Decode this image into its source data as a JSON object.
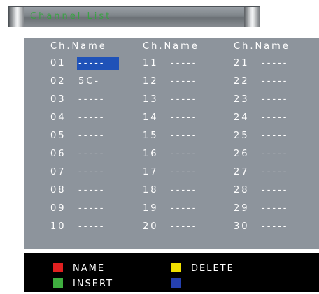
{
  "title": "Channel List",
  "column_header": "Ch.Name",
  "selected_channel": "01",
  "channels": [
    {
      "num": "01",
      "name": "-----"
    },
    {
      "num": "02",
      "name": "5C-"
    },
    {
      "num": "03",
      "name": "-----"
    },
    {
      "num": "04",
      "name": "-----"
    },
    {
      "num": "05",
      "name": "-----"
    },
    {
      "num": "06",
      "name": "-----"
    },
    {
      "num": "07",
      "name": "-----"
    },
    {
      "num": "08",
      "name": "-----"
    },
    {
      "num": "09",
      "name": "-----"
    },
    {
      "num": "10",
      "name": "-----"
    },
    {
      "num": "11",
      "name": "-----"
    },
    {
      "num": "12",
      "name": "-----"
    },
    {
      "num": "13",
      "name": "-----"
    },
    {
      "num": "14",
      "name": "-----"
    },
    {
      "num": "15",
      "name": "-----"
    },
    {
      "num": "16",
      "name": "-----"
    },
    {
      "num": "17",
      "name": "-----"
    },
    {
      "num": "18",
      "name": "-----"
    },
    {
      "num": "19",
      "name": "-----"
    },
    {
      "num": "20",
      "name": "-----"
    },
    {
      "num": "21",
      "name": "-----"
    },
    {
      "num": "22",
      "name": "-----"
    },
    {
      "num": "23",
      "name": "-----"
    },
    {
      "num": "24",
      "name": "-----"
    },
    {
      "num": "25",
      "name": "-----"
    },
    {
      "num": "26",
      "name": "-----"
    },
    {
      "num": "27",
      "name": "-----"
    },
    {
      "num": "28",
      "name": "-----"
    },
    {
      "num": "29",
      "name": "-----"
    },
    {
      "num": "30",
      "name": "-----"
    }
  ],
  "legend": {
    "red": {
      "label": "NAME",
      "color": "#e02020"
    },
    "yellow": {
      "label": "DELETE",
      "color": "#f0e000"
    },
    "green": {
      "label": "INSERT",
      "color": "#3fae3f"
    },
    "blue": {
      "label": "",
      "color": "#2540b0"
    }
  }
}
